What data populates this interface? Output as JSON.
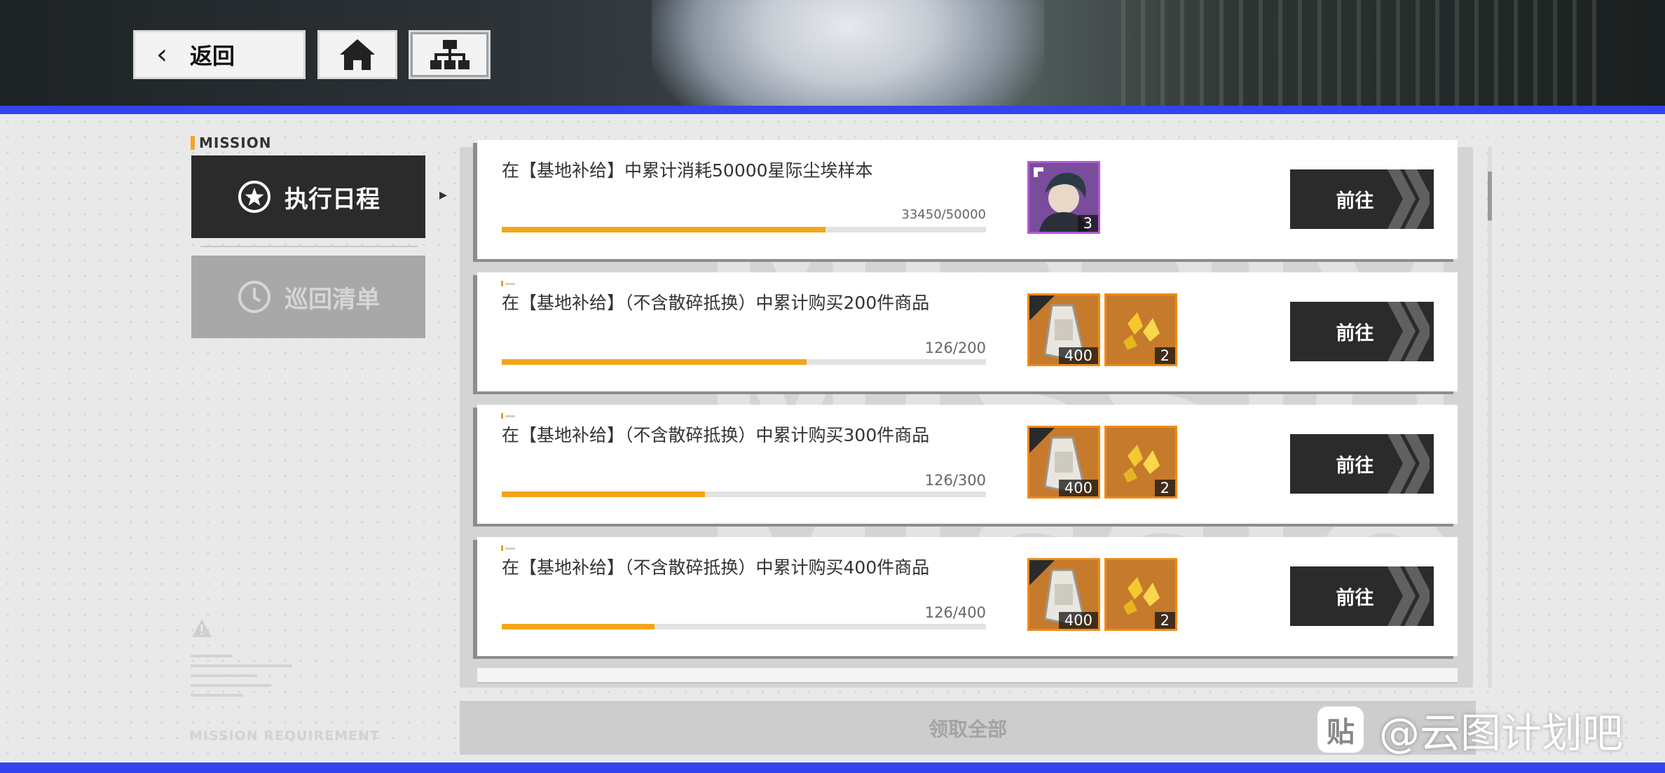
{
  "header": {
    "back_label": "返回"
  },
  "sidebar": {
    "section_label": "MISSION",
    "tabs": [
      {
        "label": "执行日程",
        "active": true
      },
      {
        "label": "巡回清单",
        "active": false
      }
    ],
    "requirement_label": "MISSION REQUIREMENT"
  },
  "missions": [
    {
      "title": "在【基地补给】中累计消耗50000星际尘埃样本",
      "progress_text": "33450/50000",
      "progress": 0.669,
      "rewards": [
        {
          "icon": "character-portrait",
          "qty": "3",
          "style": "purple"
        }
      ],
      "action_label": "前往"
    },
    {
      "title": "在【基地补给】（不含散碎抵换）中累计购买200件商品",
      "progress_text": "126/200",
      "progress": 0.63,
      "rewards": [
        {
          "icon": "capsule-item",
          "qty": "400",
          "style": "orange"
        },
        {
          "icon": "gold-crystal",
          "qty": "2",
          "style": "orange"
        }
      ],
      "action_label": "前往"
    },
    {
      "title": "在【基地补给】（不含散碎抵换）中累计购买300件商品",
      "progress_text": "126/300",
      "progress": 0.42,
      "rewards": [
        {
          "icon": "capsule-item",
          "qty": "400",
          "style": "orange"
        },
        {
          "icon": "gold-crystal",
          "qty": "2",
          "style": "orange"
        }
      ],
      "action_label": "前往"
    },
    {
      "title": "在【基地补给】（不含散碎抵换）中累计购买400件商品",
      "progress_text": "126/400",
      "progress": 0.315,
      "rewards": [
        {
          "icon": "capsule-item",
          "qty": "400",
          "style": "orange"
        },
        {
          "icon": "gold-crystal",
          "qty": "2",
          "style": "orange"
        }
      ],
      "action_label": "前往"
    }
  ],
  "footer": {
    "claim_all_label": "领取全部"
  },
  "watermark": {
    "logo_char": "贴",
    "text": "@云图计划吧"
  },
  "colors": {
    "accent_blue": "#3343f0",
    "progress": "#f2a517",
    "button_dark": "#2b2b2b"
  }
}
